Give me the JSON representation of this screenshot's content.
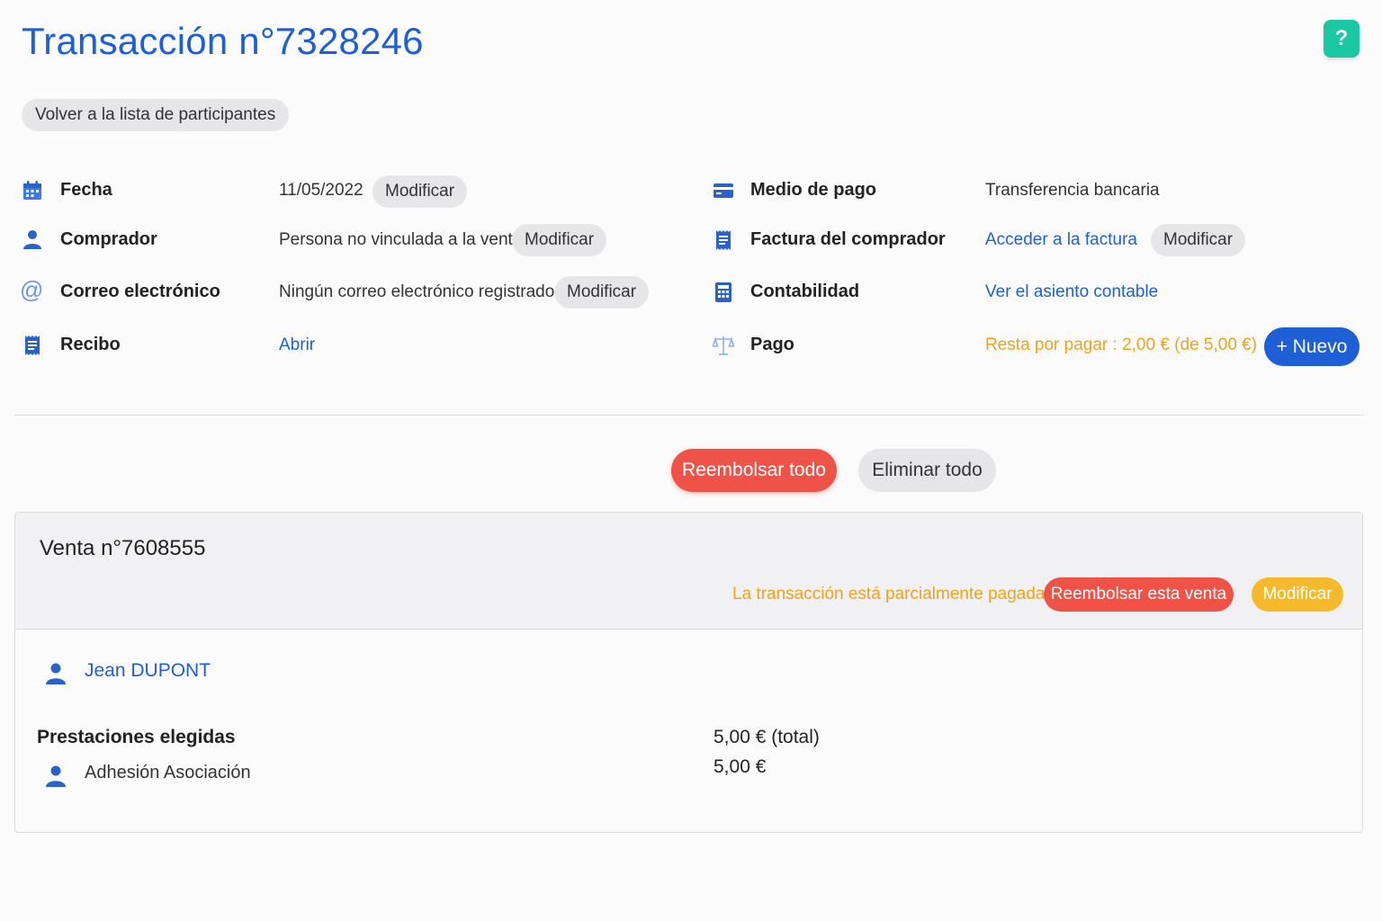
{
  "header": {
    "title": "Transacción n°7328246",
    "help_label": "?",
    "back_label": "Volver a la lista de participantes"
  },
  "details_left": [
    {
      "label": "Fecha",
      "value": "11/05/2022",
      "action": "Modificar",
      "icon": "calendar-icon"
    },
    {
      "label": "Comprador",
      "value": "Persona no vinculada a la venta",
      "action": "Modificar",
      "icon": "user-icon"
    },
    {
      "label": "Correo electrónico",
      "value": "Ningún correo electrónico registrado.",
      "action": "Modificar",
      "icon": "at-icon"
    },
    {
      "label": "Recibo",
      "value": "Abrir",
      "icon": "receipt-icon"
    }
  ],
  "details_right": [
    {
      "label": "Medio de pago",
      "value": "Transferencia bancaria",
      "icon": "credit-card-icon"
    },
    {
      "label": "Factura del comprador",
      "value": "Acceder a la factura",
      "action": "Modificar",
      "icon": "invoice-icon"
    },
    {
      "label": "Contabilidad",
      "value": "Ver el asiento contable",
      "icon": "calculator-icon"
    },
    {
      "label": "Pago",
      "value": "Resta por pagar : 2,00 € (de 5,00 €)",
      "action": "+ Nuevo",
      "icon": "scale-icon"
    }
  ],
  "actions": {
    "refund_all": "Reembolsar todo",
    "delete_all": "Eliminar todo"
  },
  "sale": {
    "title": "Venta n°7608555",
    "status": "La transacción está parcialmente pagada.",
    "refund_label": "Reembolsar esta venta",
    "modify_label": "Modificar",
    "person": "Jean DUPONT",
    "services_label": "Prestaciones elegidas",
    "total": "5,00 € (total)",
    "services": [
      {
        "name": "Adhesión Asociación",
        "price": "5,00 €"
      }
    ]
  },
  "colors": {
    "primary": "#1e5fd6",
    "danger": "#ef5247",
    "warning": "#f0a21a",
    "warning_button": "#f5b92e",
    "help": "#1cc7a3"
  }
}
